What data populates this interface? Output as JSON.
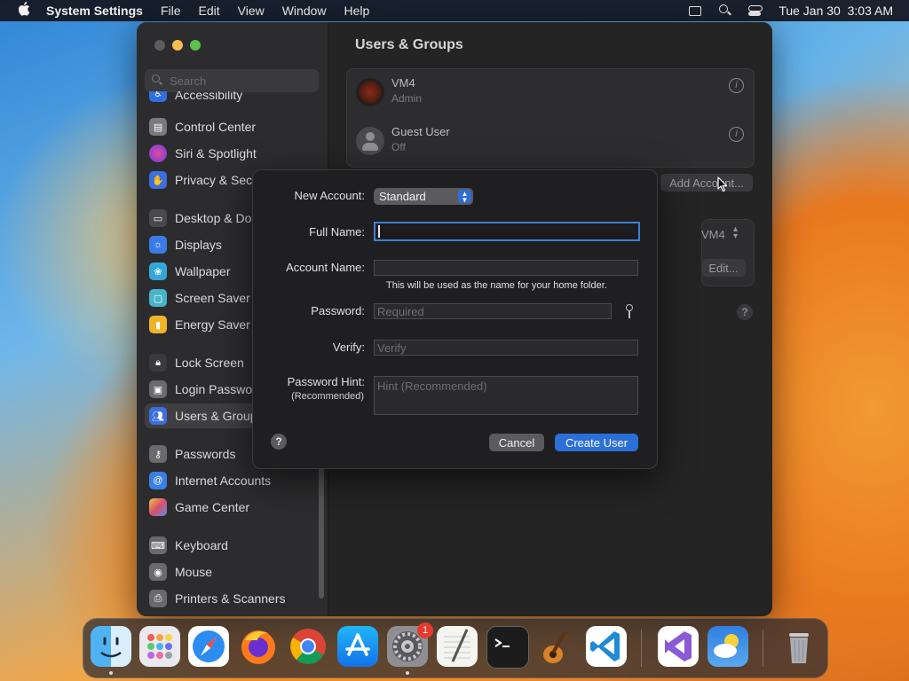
{
  "menubar": {
    "app_name": "System Settings",
    "menus": [
      "File",
      "Edit",
      "View",
      "Window",
      "Help"
    ],
    "clock": "Tue Jan 30  3:03 AM"
  },
  "sidebar": {
    "search_placeholder": "Search",
    "items": [
      {
        "label": "Accessibility",
        "icon": "accessibility-icon",
        "color": "#2f6fdf"
      },
      {
        "label": "Control Center",
        "icon": "control-center-icon",
        "color": "#7a7a7e"
      },
      {
        "label": "Siri & Spotlight",
        "icon": "siri-icon",
        "color": "#b03bd8"
      },
      {
        "label": "Privacy & Security",
        "icon": "privacy-hand-icon",
        "color": "#3b6fe0"
      },
      {
        "label": "Desktop & Dock",
        "icon": "desktop-dock-icon",
        "color": "#4a4a4c"
      },
      {
        "label": "Displays",
        "icon": "displays-icon",
        "color": "#3a7be6"
      },
      {
        "label": "Wallpaper",
        "icon": "wallpaper-icon",
        "color": "#35a7d8"
      },
      {
        "label": "Screen Saver",
        "icon": "screen-saver-icon",
        "color": "#47b5c9"
      },
      {
        "label": "Energy Saver",
        "icon": "energy-saver-icon",
        "color": "#f0b428"
      },
      {
        "label": "Lock Screen",
        "icon": "lock-icon",
        "color": "#3a3a3c"
      },
      {
        "label": "Login Password",
        "icon": "login-password-icon",
        "color": "#6a6a6e"
      },
      {
        "label": "Users & Groups",
        "icon": "users-groups-icon",
        "color": "#3b6fe0"
      },
      {
        "label": "Passwords",
        "icon": "key-icon",
        "color": "#6a6a6e"
      },
      {
        "label": "Internet Accounts",
        "icon": "at-icon",
        "color": "#3b7fe6"
      },
      {
        "label": "Game Center",
        "icon": "game-center-icon",
        "color": "#d94f6a"
      },
      {
        "label": "Keyboard",
        "icon": "keyboard-icon",
        "color": "#6a6a6e"
      },
      {
        "label": "Mouse",
        "icon": "mouse-icon",
        "color": "#6a6a6e"
      },
      {
        "label": "Printers & Scanners",
        "icon": "printer-icon",
        "color": "#6a6a6e"
      }
    ]
  },
  "content": {
    "title": "Users & Groups",
    "users": [
      {
        "name": "VM4",
        "role": "Admin"
      },
      {
        "name": "Guest User",
        "role": "Off"
      }
    ],
    "add_account_label": "Add Account...",
    "auto_login_value": "VM4",
    "edit_label": "Edit...",
    "help_label": "?"
  },
  "dialog": {
    "new_account_label": "New Account:",
    "account_type": "Standard",
    "full_name_label": "Full Name:",
    "full_name_value": "",
    "account_name_label": "Account Name:",
    "account_name_value": "",
    "account_name_hint": "This will be used as the name for your home folder.",
    "password_label": "Password:",
    "password_placeholder": "Required",
    "verify_label": "Verify:",
    "verify_placeholder": "Verify",
    "hint_label": "Password Hint:",
    "hint_sublabel": "(Recommended)",
    "hint_placeholder": "Hint (Recommended)",
    "help_label": "?",
    "cancel_label": "Cancel",
    "create_label": "Create User"
  },
  "dock": {
    "apps": [
      {
        "name": "finder-icon",
        "running": true
      },
      {
        "name": "launchpad-icon",
        "running": false
      },
      {
        "name": "safari-icon",
        "running": false
      },
      {
        "name": "firefox-icon",
        "running": false
      },
      {
        "name": "chrome-icon",
        "running": false
      },
      {
        "name": "app-store-icon",
        "running": false
      },
      {
        "name": "system-settings-icon",
        "running": true,
        "badge": "1"
      },
      {
        "name": "textedit-icon",
        "running": false
      },
      {
        "name": "terminal-icon",
        "running": false
      },
      {
        "name": "garageband-icon",
        "running": false
      },
      {
        "name": "vscode-icon",
        "running": false
      },
      {
        "name": "visual-studio-icon",
        "running": false
      },
      {
        "name": "weather-icon",
        "running": false
      },
      {
        "name": "trash-icon",
        "running": false
      }
    ]
  }
}
